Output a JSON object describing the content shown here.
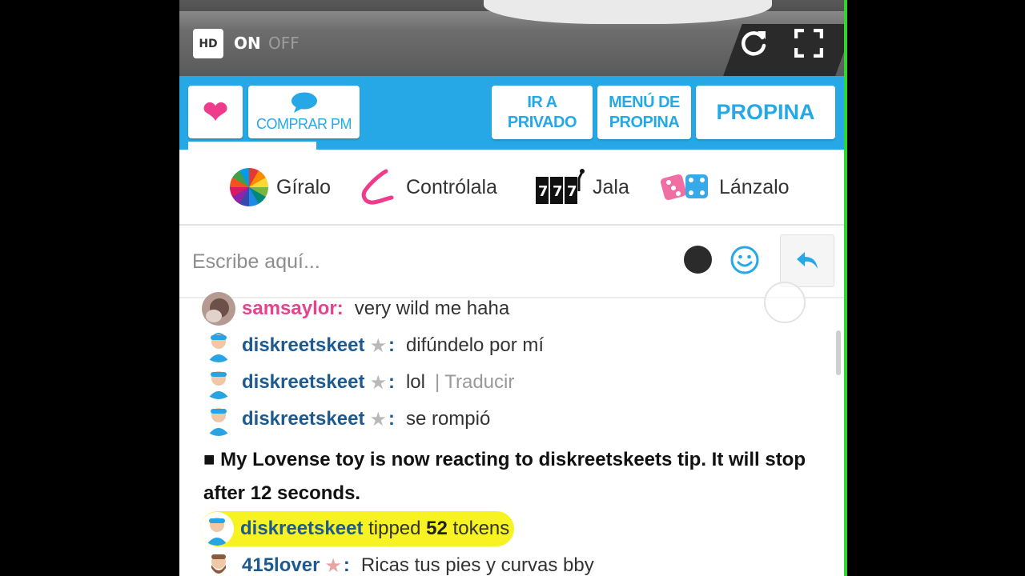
{
  "video": {
    "hd_label": "HD",
    "on_label": "ON",
    "off_label": "OFF"
  },
  "toolbar": {
    "buy_pm_label": "COMPRAR PM",
    "private_label_line1": "IR A",
    "private_label_line2": "PRIVADO",
    "tip_menu_line1": "MENÚ DE",
    "tip_menu_line2": "PROPINA",
    "tip_label": "PROPINA"
  },
  "games": [
    {
      "label": "Gíralo",
      "icon": "color-wheel-icon"
    },
    {
      "label": "Contrólala",
      "icon": "lovense-toy-icon"
    },
    {
      "label": "Jala",
      "icon": "slot-machine-icon"
    },
    {
      "label": "Lánzalo",
      "icon": "dice-icon"
    }
  ],
  "chat_input": {
    "placeholder": "Escribe aquí..."
  },
  "messages": [
    {
      "user": "samsaylor",
      "text": "very wild me haha"
    },
    {
      "user": "diskreetskeet",
      "text": "difúndelo por mí"
    },
    {
      "user": "diskreetskeet",
      "text": "lol",
      "translate": "Traducir"
    },
    {
      "user": "diskreetskeet",
      "text": "se rompió"
    }
  ],
  "system_message": "■ My Lovense toy is now reacting to diskreetskeets tip. It will stop after 12 seconds.",
  "tip": {
    "user": "diskreetskeet",
    "text_before": "tipped",
    "amount": "52",
    "text_after": "tokens"
  },
  "last_message": {
    "user": "415lover",
    "text": "Ricas tus pies y curvas bby"
  },
  "colors": {
    "brand_blue": "#27a8e6",
    "username_blue": "#1d5a8f",
    "username_pink": "#e6438f",
    "tip_highlight": "#f7f322"
  }
}
